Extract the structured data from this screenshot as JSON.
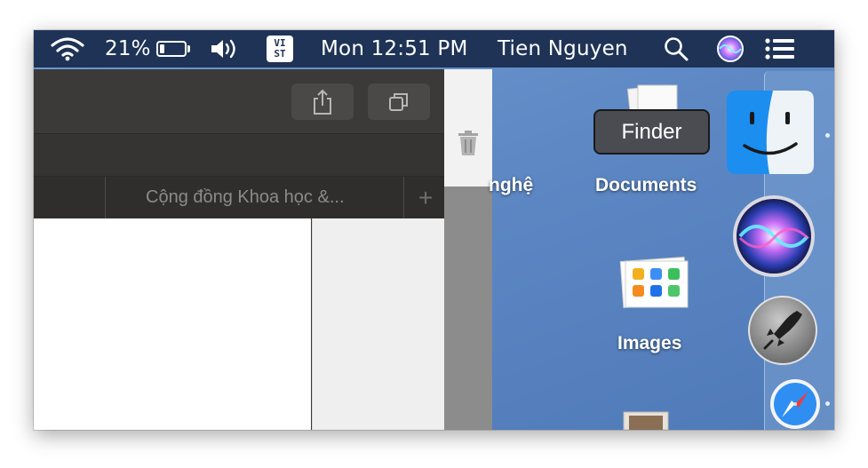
{
  "menubar": {
    "battery_percent": "21%",
    "battery_level": 0.21,
    "input_method": {
      "top": "VI",
      "bottom": "ST"
    },
    "clock": "Mon 12:51 PM",
    "user": "Tien Nguyen"
  },
  "browser": {
    "tab_label": "Cộng đồng Khoa học &...",
    "new_tab_symbol": "+"
  },
  "desktop": {
    "partial_label": "nghệ",
    "documents_label": "Documents",
    "images_label": "Images"
  },
  "dock": {
    "tooltip": "Finder",
    "items": [
      "finder-icon",
      "siri-icon",
      "launchpad-icon",
      "safari-icon"
    ]
  },
  "colors": {
    "menubar": "#1e3356",
    "wallpaper": "#5d88c4",
    "window": "#3a3938"
  }
}
